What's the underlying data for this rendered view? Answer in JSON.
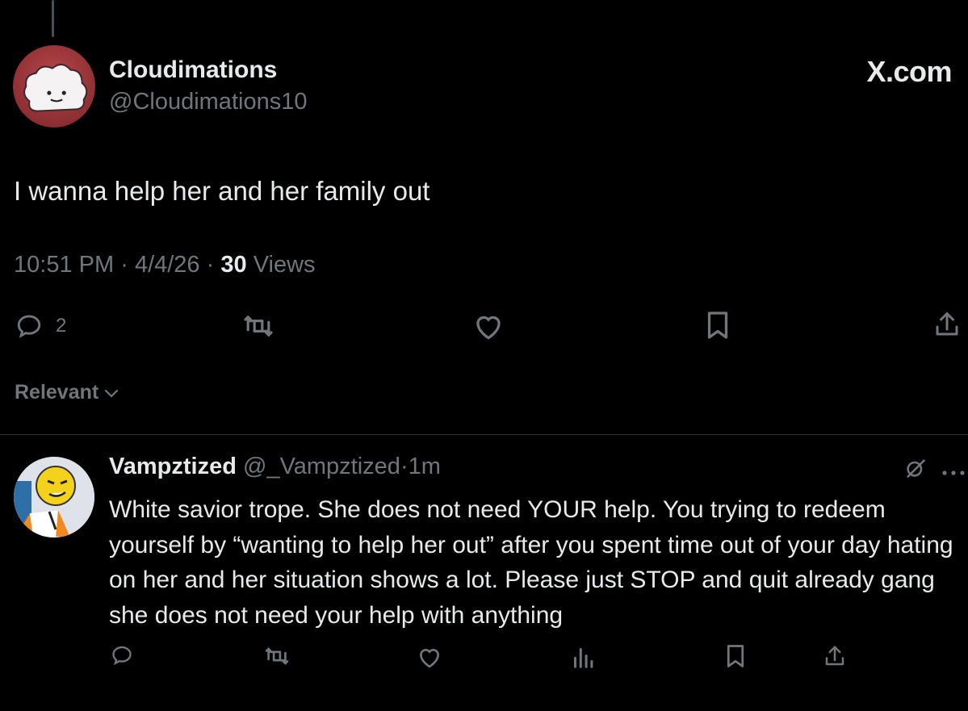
{
  "colors": {
    "background": "#000000",
    "primary_text": "#e7e9ea",
    "secondary_text": "#71767b",
    "divider": "#2f3336"
  },
  "brand": {
    "watermark": "X.com"
  },
  "tweet": {
    "author_name": "Cloudimations",
    "author_handle": "@Cloudimations10",
    "text": "I wanna help her and her family out",
    "time": "10:51 PM",
    "date": "4/4/26",
    "views_count": "30",
    "views_label": "Views",
    "separator": "·",
    "reply_count": "2",
    "icons": [
      "reply-icon",
      "repost-icon",
      "like-icon",
      "bookmark-icon",
      "share-icon"
    ]
  },
  "sort": {
    "label": "Relevant",
    "icon": "chevron-down-icon"
  },
  "reply": {
    "author_name": "Vampztized",
    "author_handle": "@_Vampztized",
    "separator": "·",
    "time": "1m",
    "text": "White savior trope. She does not need YOUR help. You trying to redeem yourself by “wanting to help her out” after you spent time out of your day hating on her and her situation shows a lot. Please just STOP and quit already gang she does not need your help with anything",
    "icons": [
      "reply-icon",
      "repost-icon",
      "like-icon",
      "views-icon",
      "bookmark-icon",
      "share-icon",
      "grok-icon",
      "more-icon"
    ]
  }
}
